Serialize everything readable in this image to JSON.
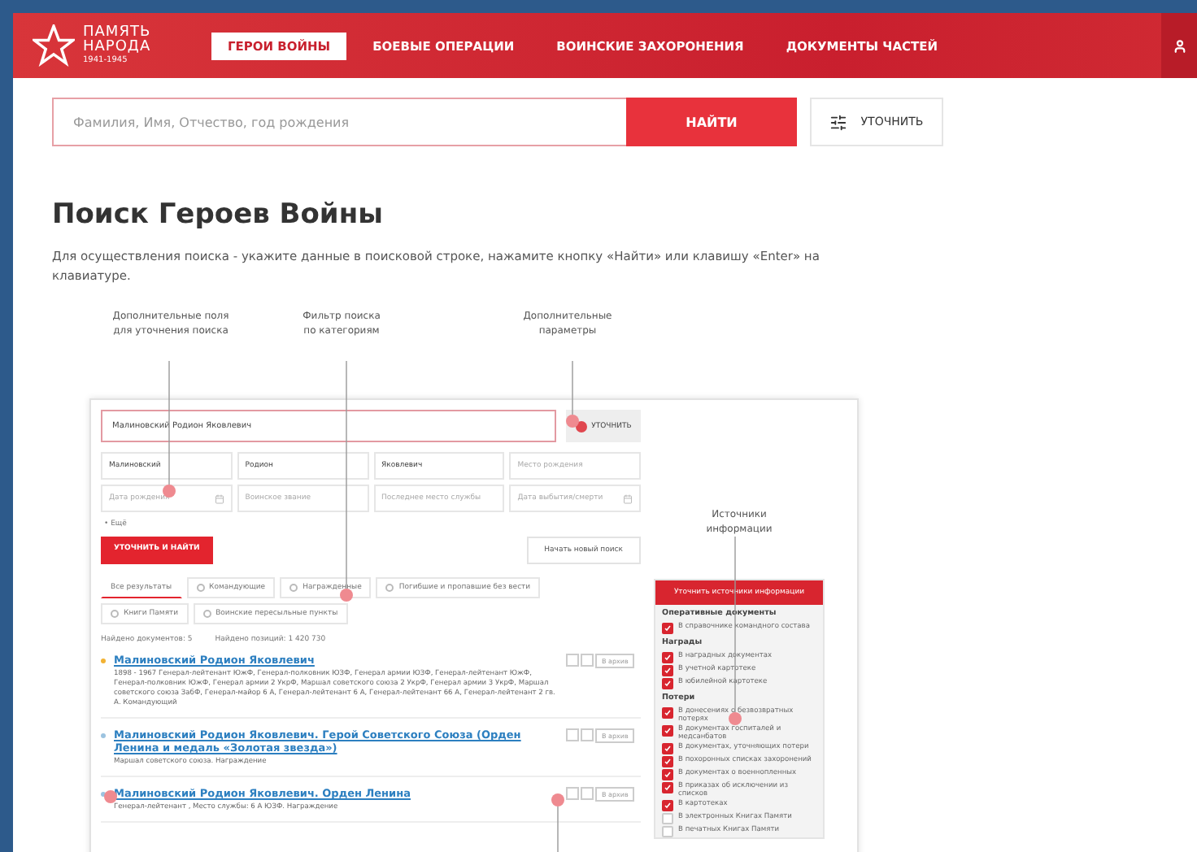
{
  "header": {
    "logo": {
      "line1": "ПАМЯТЬ",
      "line2": "НАРОДА",
      "years": "1941-1945"
    },
    "nav": [
      {
        "label": "ГЕРОИ ВОЙНЫ",
        "selected": true
      },
      {
        "label": "БОЕВЫЕ ОПЕРАЦИИ",
        "selected": false
      },
      {
        "label": "ВОИНСКИЕ ЗАХОРОНЕНИЯ",
        "selected": false
      },
      {
        "label": "ДОКУМЕНТЫ ЧАСТЕЙ",
        "selected": false
      }
    ]
  },
  "search": {
    "placeholder": "Фамилия, Имя, Отчество, год рождения",
    "button": "НАЙТИ",
    "refine": "УТОЧНИТЬ"
  },
  "title": "Поиск Героев Войны",
  "description": "Для осуществления поиска - укажите данные в поисковой строке, нажамите кнопку «Найти» или клавишу «Enter» на клавиатуре.",
  "illustration": {
    "callouts": [
      "Дополнительные поля\nдля уточнения поиска",
      "Фильтр поиска\nпо категориям",
      "Дополнительные\nпараметры"
    ],
    "sources_callout": "Источники\nинформации",
    "screenshot": {
      "search_value": "Малиновский Родион Яковлевич",
      "refine": "УТОЧНИТЬ",
      "fields": [
        {
          "kind": "text",
          "value": "Малиновский"
        },
        {
          "kind": "text",
          "value": "Родион"
        },
        {
          "kind": "text",
          "value": "Яковлевич"
        },
        {
          "kind": "text",
          "placeholder": "Место рождения"
        },
        {
          "kind": "date",
          "placeholder": "Дата рождения"
        },
        {
          "kind": "text",
          "placeholder": "Воинское звание"
        },
        {
          "kind": "text",
          "placeholder": "Последнее место службы"
        },
        {
          "kind": "date",
          "placeholder": "Дата выбытия/смерти"
        }
      ],
      "more": "• Ещё",
      "submit": "УТОЧНИТЬ И НАЙТИ",
      "reset": "Начать новый поиск",
      "tabs": [
        {
          "label": "Все результаты",
          "selected": true
        },
        {
          "label": "Командующие",
          "selected": false
        },
        {
          "label": "Награжденные",
          "selected": false
        },
        {
          "label": "Погибшие и пропавшие без вести",
          "selected": false
        },
        {
          "label": "Книги Памяти",
          "selected": false
        },
        {
          "label": "Воинские пересыльные пункты",
          "selected": false
        }
      ],
      "counts": [
        "Найдено документов: 5",
        "Найдено позиций: 1 420 730"
      ],
      "results": [
        {
          "title": "Малиновский Родион Яковлевич",
          "color": "#f2b233",
          "action": "В архив",
          "description": "1898 - 1967 Генерал-лейтенант ЮжФ, Генерал-полковник ЮЗФ, Генерал армии ЮЗФ, Генерал-лейтенант ЮжФ, Генерал-полковник ЮжФ, Генерал армии 2 УкрФ, Маршал советского союза 2 УкрФ, Генерал армии 3 УкрФ, Маршал советского союза ЗабФ, Генерал-майор 6 А, Генерал-лейтенант 6 А, Генерал-лейтенант 66 А, Генерал-лейтенант 2 гв. А. Командующий"
        },
        {
          "title": "Малиновский Родион Яковлевич. Герой Советского Союза (Орден Ленина и медаль «Золотая звезда»)",
          "color": "#9cc3e0",
          "action": "В архив",
          "description": "Маршал советского союза. Награждение"
        },
        {
          "title": "Малиновский Родион Яковлевич. Орден Ленина",
          "color": "#9cc3e0",
          "action": "В архив",
          "description": "Генерал-лейтенант , Место службы: 6 А ЮЗФ. Награждение"
        }
      ],
      "sources": {
        "header": "Уточнить источники информации",
        "groups": [
          {
            "title": "Оперативные документы",
            "items": [
              {
                "label": "В справочнике командного состава",
                "checked": true
              }
            ]
          },
          {
            "title": "Награды",
            "items": [
              {
                "label": "В наградных документах",
                "checked": true
              },
              {
                "label": "В учетной картотеке",
                "checked": true
              },
              {
                "label": "В юбилейной картотеке",
                "checked": true
              }
            ]
          },
          {
            "title": "Потери",
            "items": [
              {
                "label": "В донесениях о безвозвратных потерях",
                "checked": true
              },
              {
                "label": "В документах госпиталей и медсанбатов",
                "checked": true
              },
              {
                "label": "В документах, уточняющих потери",
                "checked": true
              },
              {
                "label": "В похоронных списках захоронений",
                "checked": true
              },
              {
                "label": "В документах о военнопленных",
                "checked": true
              },
              {
                "label": "В приказах об исключении из списков",
                "checked": true
              },
              {
                "label": "В картотеках",
                "checked": true
              },
              {
                "label": "В электронных Книгах Памяти",
                "checked": false
              },
              {
                "label": "В печатных Книгах Памяти",
                "checked": false
              }
            ]
          }
        ]
      }
    }
  }
}
